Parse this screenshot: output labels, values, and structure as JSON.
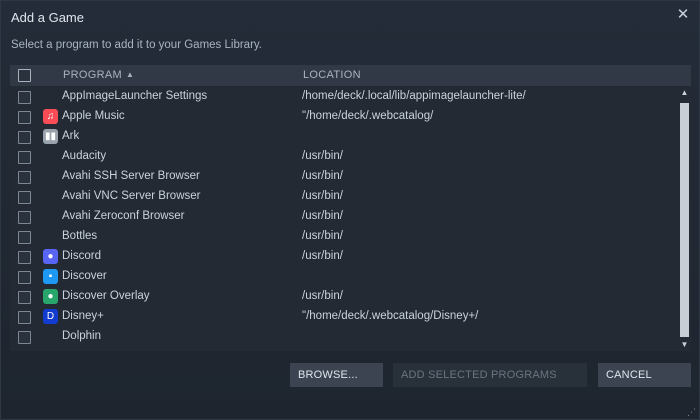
{
  "window": {
    "title": "Add a Game",
    "close_glyph": "✕"
  },
  "subtitle": "Select a program to add it to your Games Library.",
  "list": {
    "header": {
      "program": "PROGRAM",
      "location": "LOCATION",
      "sort_indicator": "▲"
    },
    "rows": [
      {
        "program": "AppImageLauncher Settings",
        "location": "/home/deck/.local/lib/appimagelauncher-lite/",
        "icon": "none"
      },
      {
        "program": "Apple Music",
        "location": "\"/home/deck/.webcatalog/",
        "icon": "apple-music-icon",
        "icon_glyph": "♫",
        "icon_color": "#f94c57"
      },
      {
        "program": "Ark",
        "location": "",
        "icon": "ark-icon",
        "icon_glyph": "▮▮",
        "icon_color": "#9aa3ad"
      },
      {
        "program": "Audacity",
        "location": "/usr/bin/",
        "icon": "none"
      },
      {
        "program": "Avahi SSH Server Browser",
        "location": "/usr/bin/",
        "icon": "none"
      },
      {
        "program": "Avahi VNC Server Browser",
        "location": "/usr/bin/",
        "icon": "none"
      },
      {
        "program": "Avahi Zeroconf Browser",
        "location": "/usr/bin/",
        "icon": "none"
      },
      {
        "program": "Bottles",
        "location": "/usr/bin/",
        "icon": "none"
      },
      {
        "program": "Discord",
        "location": "/usr/bin/",
        "icon": "discord-icon",
        "icon_glyph": "●",
        "icon_color": "#5865f2"
      },
      {
        "program": "Discover",
        "location": "",
        "icon": "discover-icon",
        "icon_glyph": "▪",
        "icon_color": "#1d99f3"
      },
      {
        "program": "Discover Overlay",
        "location": "/usr/bin/",
        "icon": "discover-overlay-icon",
        "icon_glyph": "●",
        "icon_color": "#27a56a"
      },
      {
        "program": "Disney+",
        "location": "\"/home/deck/.webcatalog/Disney+/",
        "icon": "disney-plus-icon",
        "icon_glyph": "D",
        "icon_color": "#113ccf"
      },
      {
        "program": "Dolphin",
        "location": "",
        "icon": "none"
      }
    ]
  },
  "scrollbar": {
    "up_glyph": "▲",
    "down_glyph": "▼"
  },
  "buttons": {
    "browse": "BROWSE...",
    "add_selected": "ADD SELECTED PROGRAMS",
    "cancel": "CANCEL"
  },
  "colors": {
    "background": "#1f2732",
    "header": "#303945",
    "button": "#3b4450",
    "button_disabled": "#283039"
  }
}
